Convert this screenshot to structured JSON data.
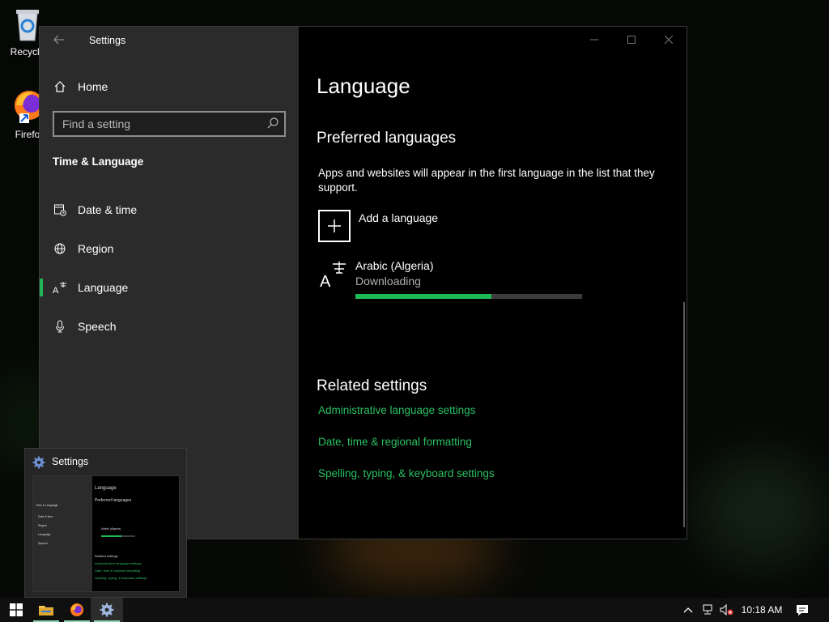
{
  "desktop": {
    "icons": [
      {
        "name": "recycle-bin-icon",
        "label": "Recycle"
      },
      {
        "name": "firefox-desktop-icon",
        "label": "Firefo"
      }
    ]
  },
  "window": {
    "title": "Settings",
    "controls": {
      "minimize": "minimize-icon",
      "maximize": "maximize-icon",
      "close": "close-icon"
    }
  },
  "sidebar": {
    "home_label": "Home",
    "search_placeholder": "Find a setting",
    "section_title": "Time & Language",
    "items": [
      {
        "label": "Date & time",
        "icon": "calendar-clock-icon"
      },
      {
        "label": "Region",
        "icon": "globe-icon"
      },
      {
        "label": "Language",
        "icon": "language-icon",
        "active": true
      },
      {
        "label": "Speech",
        "icon": "microphone-icon"
      }
    ]
  },
  "main": {
    "page_title": "Language",
    "preferred_heading": "Preferred languages",
    "preferred_desc": "Apps and websites will appear in the first language in the list that they support.",
    "add_language_label": "Add a language",
    "language_entry": {
      "name": "Arabic (Algeria)",
      "status": "Downloading",
      "progress": 0.6
    },
    "related_heading": "Related settings",
    "related_links": [
      "Administrative language settings",
      "Date, time & regional formatting",
      "Spelling, typing, & keyboard settings"
    ]
  },
  "preview": {
    "title": "Settings"
  },
  "taskbar": {
    "clock": "10:18 AM",
    "apps": [
      "start-icon",
      "file-explorer-icon",
      "firefox-icon",
      "settings-gear-icon"
    ]
  },
  "colors": {
    "accent": "#1db954",
    "link": "#2bc063",
    "sidebar_bg": "#2b2b2b",
    "content_bg": "#000000"
  }
}
